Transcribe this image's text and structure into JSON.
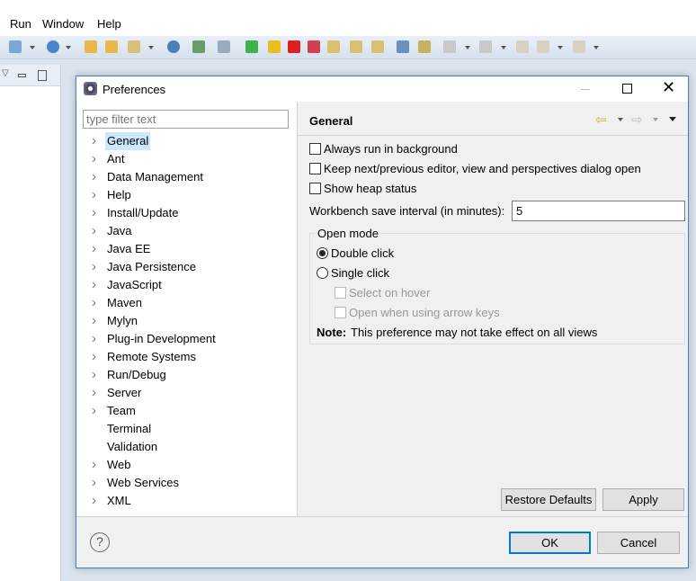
{
  "menubar": {
    "items": [
      "Run",
      "Window",
      "Help"
    ]
  },
  "dialog": {
    "title": "Preferences",
    "filter_placeholder": "type filter text",
    "tree": [
      {
        "label": "General",
        "expandable": true,
        "selected": true
      },
      {
        "label": "Ant",
        "expandable": true
      },
      {
        "label": "Data Management",
        "expandable": true
      },
      {
        "label": "Help",
        "expandable": true
      },
      {
        "label": "Install/Update",
        "expandable": true
      },
      {
        "label": "Java",
        "expandable": true
      },
      {
        "label": "Java EE",
        "expandable": true
      },
      {
        "label": "Java Persistence",
        "expandable": true
      },
      {
        "label": "JavaScript",
        "expandable": true
      },
      {
        "label": "Maven",
        "expandable": true
      },
      {
        "label": "Mylyn",
        "expandable": true
      },
      {
        "label": "Plug-in Development",
        "expandable": true
      },
      {
        "label": "Remote Systems",
        "expandable": true
      },
      {
        "label": "Run/Debug",
        "expandable": true
      },
      {
        "label": "Server",
        "expandable": true
      },
      {
        "label": "Team",
        "expandable": true
      },
      {
        "label": "Terminal",
        "expandable": false
      },
      {
        "label": "Validation",
        "expandable": false
      },
      {
        "label": "Web",
        "expandable": true
      },
      {
        "label": "Web Services",
        "expandable": true
      },
      {
        "label": "XML",
        "expandable": true
      }
    ],
    "page": {
      "title": "General",
      "always_run_bg": {
        "label": "Always run in background",
        "checked": false
      },
      "keep_next_prev": {
        "label": "Keep next/previous editor, view and perspectives dialog open",
        "checked": false
      },
      "show_heap": {
        "label": "Show heap status",
        "checked": false
      },
      "save_interval_label": "Workbench save interval (in minutes):",
      "save_interval_value": "5",
      "open_mode": {
        "legend": "Open mode",
        "double_click": "Double click",
        "single_click": "Single click",
        "selected": "Double click",
        "select_on_hover": "Select on hover",
        "open_arrow_keys": "Open when using arrow keys",
        "note_label": "Note:",
        "note_text": "This preference may not take effect on all views"
      },
      "restore_defaults": "Restore Defaults",
      "apply": "Apply"
    },
    "ok": "OK",
    "cancel": "Cancel"
  },
  "colors": {
    "accent": "#0078d7",
    "selection": "#cce8ff",
    "dialog_border": "#3c83c4"
  }
}
